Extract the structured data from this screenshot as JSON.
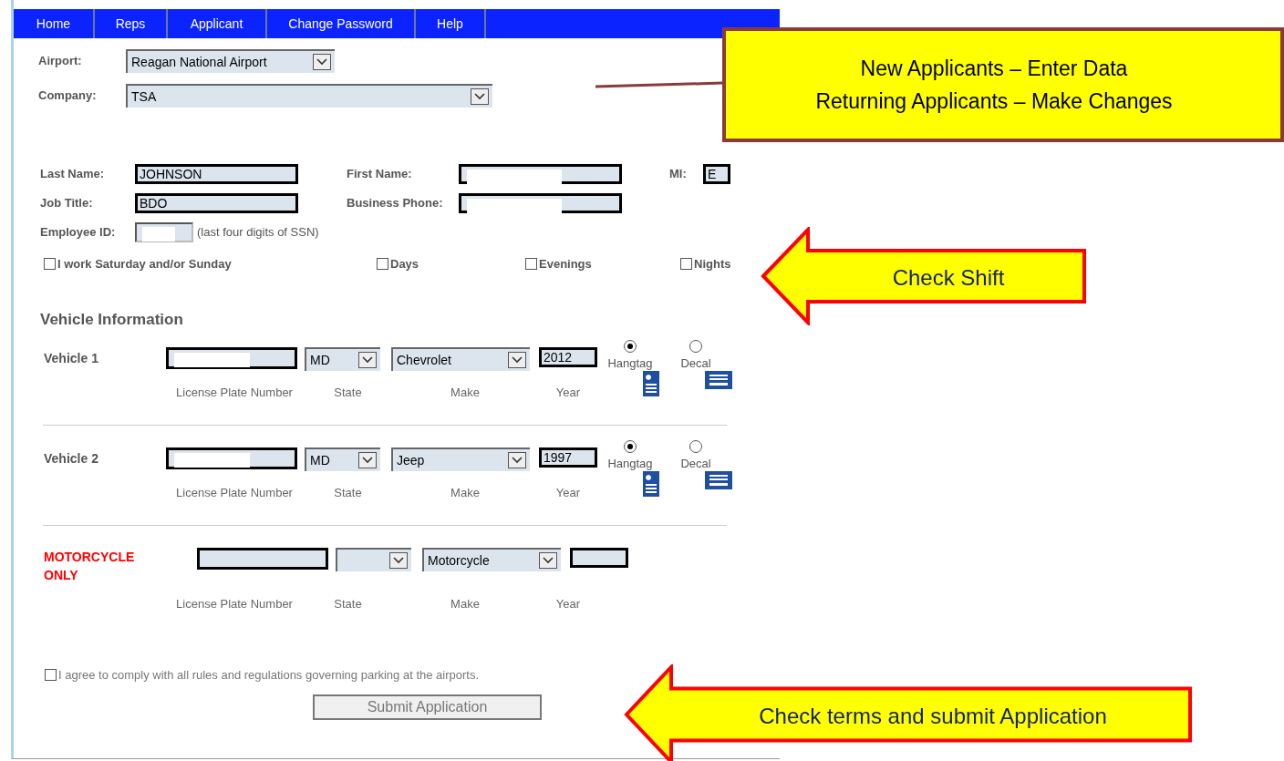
{
  "nav": {
    "tabs": [
      {
        "label": "Home"
      },
      {
        "label": "Reps"
      },
      {
        "label": "Applicant"
      },
      {
        "label": "Change Password"
      },
      {
        "label": "Help"
      }
    ]
  },
  "selects": [
    {
      "label": "Airport:",
      "value": "Reagan National Airport"
    },
    {
      "label": "Company:",
      "value": "TSA"
    }
  ],
  "person": {
    "last_name": {
      "label": "Last Name:",
      "value": "JOHNSON"
    },
    "first_name": {
      "label": "First Name:",
      "redacted": true
    },
    "mi": {
      "label": "MI:",
      "value": "E"
    },
    "job_title": {
      "label": "Job Title:",
      "value": "BDO"
    },
    "phone": {
      "label": "Business Phone:",
      "redacted": true
    },
    "employee_id": {
      "label": "Employee ID:",
      "redacted": true,
      "hint": "(last four digits of SSN)"
    }
  },
  "shifts": [
    {
      "label": "I work Saturday and/or Sunday",
      "checked": false
    },
    {
      "label": "Days",
      "checked": false
    },
    {
      "label": "Evenings",
      "checked": false
    },
    {
      "label": "Nights",
      "checked": false
    }
  ],
  "vehicle_heading": "Vehicle Information",
  "vehicles": [
    {
      "kind": "vehicle",
      "label": "Vehicle 1",
      "plate": {
        "redacted": true
      },
      "state": "MD",
      "make": "Chevrolet",
      "year": "2012",
      "captions": [
        "License Plate Number",
        "State",
        "Make",
        "Year"
      ],
      "options": [
        {
          "label": "Hangtag",
          "selected": true
        },
        {
          "label": "Decal",
          "selected": false
        }
      ]
    },
    {
      "kind": "vehicle",
      "label": "Vehicle 2",
      "plate": {
        "redacted": true
      },
      "state": "MD",
      "make": "Jeep",
      "year": "1997",
      "captions": [
        "License Plate Number",
        "State",
        "Make",
        "Year"
      ],
      "options": [
        {
          "label": "Hangtag",
          "selected": true
        },
        {
          "label": "Decal",
          "selected": false
        }
      ]
    },
    {
      "kind": "motorcycle",
      "label": "MOTORCYCLE ONLY",
      "plate": {
        "redacted": false
      },
      "make": "Motorcycle",
      "captions": [
        "License Plate Number",
        "State",
        "Make",
        "Year"
      ]
    }
  ],
  "agreement": {
    "label": "I agree to comply with all rules and regulations governing parking at the airports.",
    "checked": false
  },
  "submit": "Submit Application",
  "callout": {
    "lines": [
      "New Applicants – Enter Data",
      "Returning Applicants – Make Changes"
    ]
  },
  "arrows": [
    {
      "label": "Check Shift"
    },
    {
      "label": "Check terms and submit Application"
    }
  ]
}
